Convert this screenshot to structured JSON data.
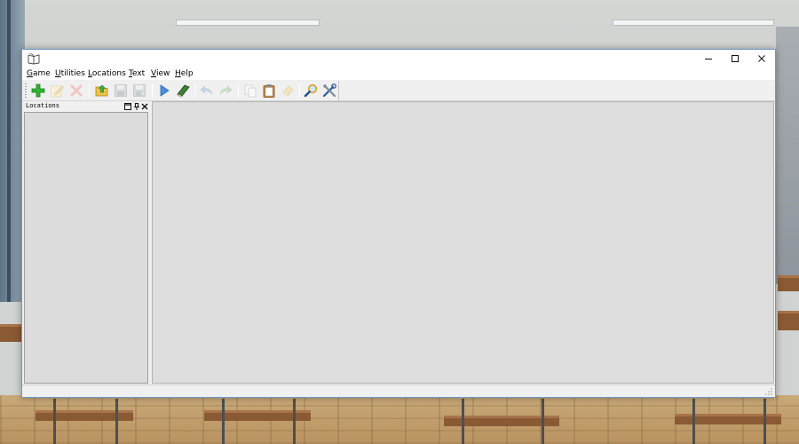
{
  "window": {
    "title": "",
    "app_icon": "open-book-icon",
    "controls": [
      {
        "name": "minimize",
        "icon": "minimize-icon"
      },
      {
        "name": "maximize",
        "icon": "maximize-icon"
      },
      {
        "name": "close",
        "icon": "close-icon"
      }
    ]
  },
  "menubar": {
    "items": [
      {
        "label": "Game",
        "accel": "G"
      },
      {
        "label": "Utilities",
        "accel": "U"
      },
      {
        "label": "Locations",
        "accel": "L"
      },
      {
        "label": "Text",
        "accel": "T"
      },
      {
        "label": "View",
        "accel": "V"
      },
      {
        "label": "Help",
        "accel": "H"
      }
    ]
  },
  "toolbar": {
    "buttons": [
      {
        "name": "add",
        "icon": "green-plus-icon",
        "enabled": true
      },
      {
        "name": "rename",
        "icon": "pencil-note-icon",
        "enabled": false
      },
      {
        "name": "delete",
        "icon": "red-cross-icon",
        "enabled": false
      },
      {
        "name": "open",
        "icon": "open-folder-icon",
        "enabled": true
      },
      {
        "name": "save",
        "icon": "save-disk-icon",
        "enabled": false
      },
      {
        "name": "save-as",
        "icon": "save-as-disk-icon",
        "enabled": false
      },
      {
        "name": "run",
        "icon": "play-arrow-icon",
        "enabled": true
      },
      {
        "name": "game-info",
        "icon": "green-book-icon",
        "enabled": true
      },
      {
        "name": "undo",
        "icon": "undo-arrow-icon",
        "enabled": false
      },
      {
        "name": "redo",
        "icon": "redo-arrow-icon",
        "enabled": false
      },
      {
        "name": "copy",
        "icon": "copy-pages-icon",
        "enabled": false
      },
      {
        "name": "paste",
        "icon": "clipboard-icon",
        "enabled": true
      },
      {
        "name": "clear",
        "icon": "eraser-icon",
        "enabled": false
      },
      {
        "name": "search",
        "icon": "magnifier-icon",
        "enabled": true
      },
      {
        "name": "settings",
        "icon": "tools-icon",
        "enabled": true
      }
    ]
  },
  "dock": {
    "title": "Locations",
    "controls": [
      "float-icon",
      "pin-icon",
      "close-icon"
    ]
  },
  "colors": {
    "window_border": "#6f98c8",
    "panel_bg": "#dcdcdc",
    "main_bg": "#dddddd",
    "chrome_bg": "#f0f0f0"
  }
}
